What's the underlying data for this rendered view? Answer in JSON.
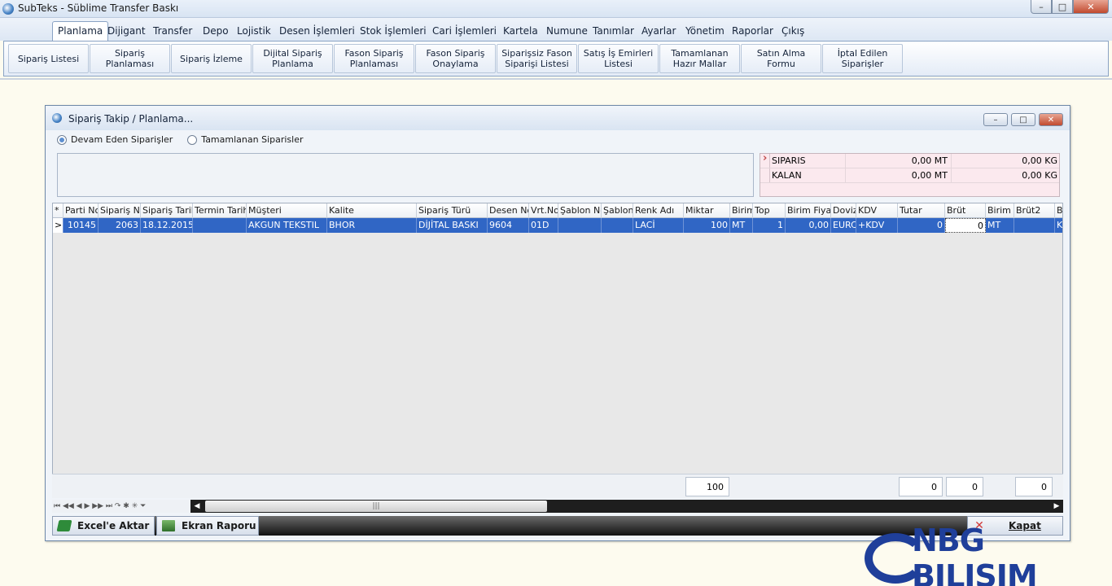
{
  "app": {
    "title": "SubTeks - Süblime Transfer Baskı"
  },
  "window_controls": {
    "minimize": "–",
    "maximize": "□",
    "close": "✕"
  },
  "menu": [
    "Planlama",
    "Dijigant",
    "Transfer",
    "Depo",
    "Lojistik",
    "Desen İşlemleri",
    "Stok İşlemleri",
    "Cari İşlemleri",
    "Kartela",
    "Numune",
    "Tanımlar",
    "Ayarlar",
    "Yönetim",
    "Raporlar",
    "Çıkış"
  ],
  "ribbon": [
    "Sipariş Listesi",
    "Sipariş Planlaması",
    "Sipariş İzleme",
    "Dijital Sipariş Planlama",
    "Fason Sipariş Planlaması",
    "Fason Sipariş Onaylama",
    "Siparişsiz Fason Siparişi Listesi",
    "Satış İş Emirleri Listesi",
    "Tamamlanan Hazır Mallar",
    "Satın Alma Formu",
    "İptal Edilen Siparişler"
  ],
  "child_window": {
    "title": "Sipariş Takip / Planlama...",
    "radio_ongoing": "Devam Eden Siparişler",
    "radio_completed": "Tamamlanan Siparisler",
    "summary": [
      {
        "label": "SIPARIS",
        "value1": "0,00",
        "unit1": "MT",
        "value2": "0,00",
        "unit2": "KG"
      },
      {
        "label": "KALAN",
        "value1": "0,00",
        "unit1": "MT",
        "value2": "0,00",
        "unit2": "KG"
      }
    ],
    "grid_headers": [
      "*",
      "Parti No",
      "Sipariş No",
      "Sipariş Tarihi",
      "Termin Tarihi",
      "Müşteri",
      "Kalite",
      "Sipariş Türü",
      "Desen No",
      "Vrt.No",
      "Şablon No",
      "Şablon",
      "Renk Adı",
      "Miktar",
      "Birim",
      "Top",
      "Birim Fiyatı",
      "Doviz",
      "KDV",
      "Tutar",
      "Brüt",
      "Birim",
      "Brüt2",
      "Bi"
    ],
    "grid_row": [
      ">",
      "10145",
      "2063",
      "18.12.2015",
      "",
      "AKGUN TEKSTIL",
      "BHOR",
      "DİJİTAL BASKI",
      "9604",
      "01D",
      "",
      "",
      "LACİ",
      "100",
      "MT",
      "1",
      "0,00",
      "EURC",
      "+KDV",
      "0",
      "0",
      "MT",
      "",
      "KG"
    ],
    "footer_totals": {
      "miktar": "100",
      "tutar": "0",
      "brut": "0",
      "brut2": "0"
    },
    "nav_symbols": "⏮ ◀◀ ◀ ▶ ▶▶ ⏭ ↷ ✱ ✳ ⏷",
    "buttons": {
      "excel": "Excel'e Aktar",
      "screen_report": "Ekran Raporu",
      "close": "Kapat"
    }
  },
  "watermark": "NBG BILIŞIM"
}
